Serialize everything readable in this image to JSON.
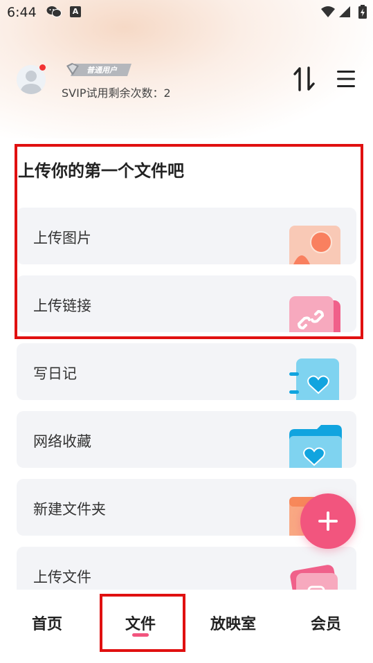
{
  "status_bar": {
    "time": "6:44",
    "icons": [
      "wechat-icon",
      "a-icon",
      "wifi-icon",
      "signal-icon",
      "battery-icon"
    ]
  },
  "header": {
    "badge_label": "普通用户",
    "svip_text": "SVIP试用剩余次数：2",
    "icons": [
      "avatar-icon",
      "sort-icon",
      "menu-icon"
    ]
  },
  "main": {
    "title": "上传你的第一个文件吧",
    "cards": [
      {
        "label": "上传图片",
        "icon": "image-icon"
      },
      {
        "label": "上传链接",
        "icon": "link-icon"
      },
      {
        "label": "写日记",
        "icon": "diary-icon"
      },
      {
        "label": "网络收藏",
        "icon": "favorite-folder-icon"
      },
      {
        "label": "新建文件夹",
        "icon": "folder-icon"
      },
      {
        "label": "上传文件",
        "icon": "file-icon"
      }
    ]
  },
  "fab": {
    "icon": "plus-icon"
  },
  "nav": {
    "items": [
      {
        "label": "首页"
      },
      {
        "label": "文件",
        "active": true
      },
      {
        "label": "放映室"
      },
      {
        "label": "会员"
      }
    ]
  },
  "colors": {
    "accent": "#f2557e",
    "highlight": "#e01010",
    "card_bg": "#f3f4f7"
  }
}
